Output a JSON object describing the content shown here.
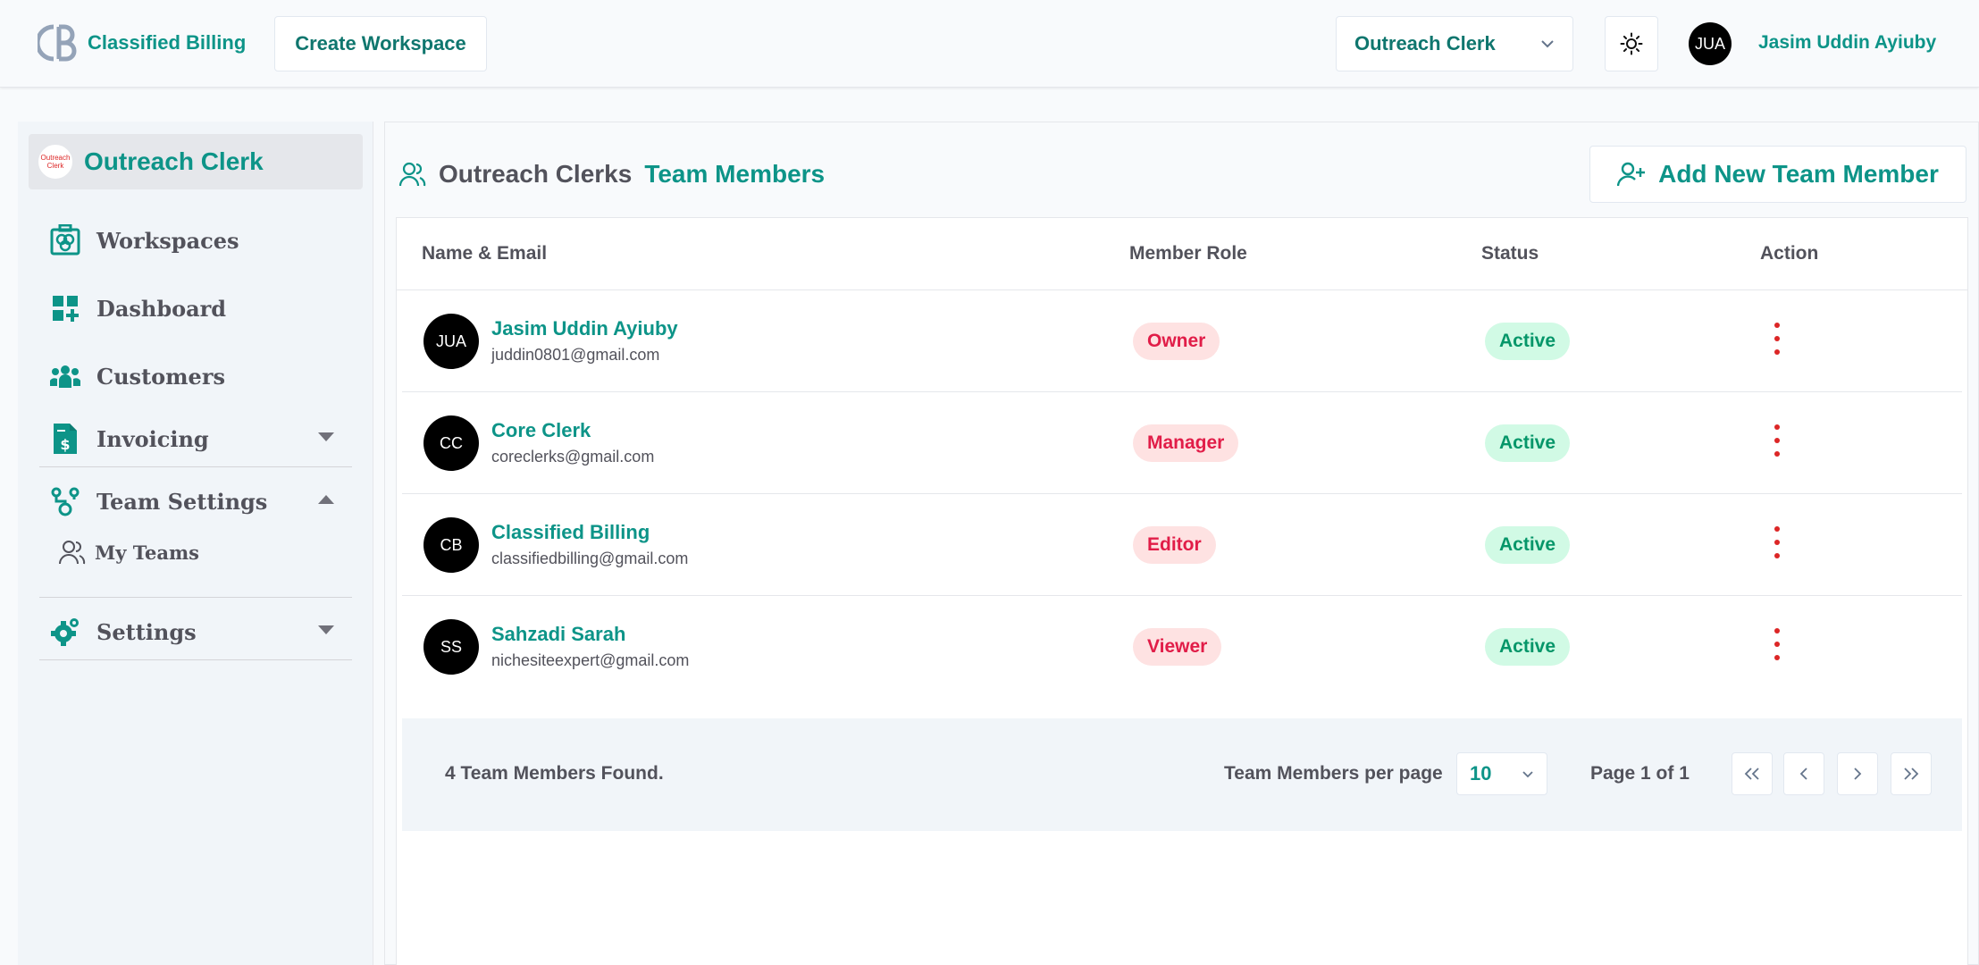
{
  "header": {
    "brand_name": "Classified Billing",
    "create_workspace_label": "Create Workspace",
    "workspace_select_value": "Outreach Clerk",
    "user_initials": "JUA",
    "user_name": "Jasim Uddin Ayiuby"
  },
  "sidebar": {
    "workspace_name": "Outreach Clerk",
    "workspace_logo_text": [
      "Outreach",
      "Clerk"
    ],
    "items": [
      {
        "label": "Workspaces",
        "icon": "workspaces-icon"
      },
      {
        "label": "Dashboard",
        "icon": "dashboard-icon"
      },
      {
        "label": "Customers",
        "icon": "customers-icon"
      },
      {
        "label": "Invoicing",
        "icon": "invoice-icon"
      },
      {
        "label": "Team Settings",
        "icon": "team-settings-icon"
      },
      {
        "label": "Settings",
        "icon": "settings-gear-icon"
      }
    ],
    "sub_items": [
      {
        "label": "My Teams",
        "icon": "users-icon"
      }
    ]
  },
  "main": {
    "title_prefix": "Outreach Clerks",
    "title_suffix": "Team Members",
    "add_button_label": "Add New Team Member",
    "columns": [
      "Name & Email",
      "Member Role",
      "Status",
      "Action"
    ],
    "members": [
      {
        "initials": "JUA",
        "name": "Jasim Uddin Ayiuby",
        "email": "juddin0801@gmail.com",
        "role": "Owner",
        "status": "Active"
      },
      {
        "initials": "CC",
        "name": "Core Clerk",
        "email": "coreclerks@gmail.com",
        "role": "Manager",
        "status": "Active"
      },
      {
        "initials": "CB",
        "name": "Classified Billing",
        "email": "classifiedbilling@gmail.com",
        "role": "Editor",
        "status": "Active"
      },
      {
        "initials": "SS",
        "name": "Sahzadi Sarah",
        "email": "nichesiteexpert@gmail.com",
        "role": "Viewer",
        "status": "Active"
      }
    ],
    "footer": {
      "found_text": "4 Team Members Found.",
      "per_page_label": "Team Members per page",
      "per_page_value": "10",
      "page_info": "Page 1 of 1"
    }
  },
  "colors": {
    "accent": "#0d9488",
    "role_bg": "#fee2e2",
    "role_text": "#e11d48",
    "status_bg": "#d1fae5",
    "status_text": "#059669",
    "kebab": "#dc2626"
  }
}
